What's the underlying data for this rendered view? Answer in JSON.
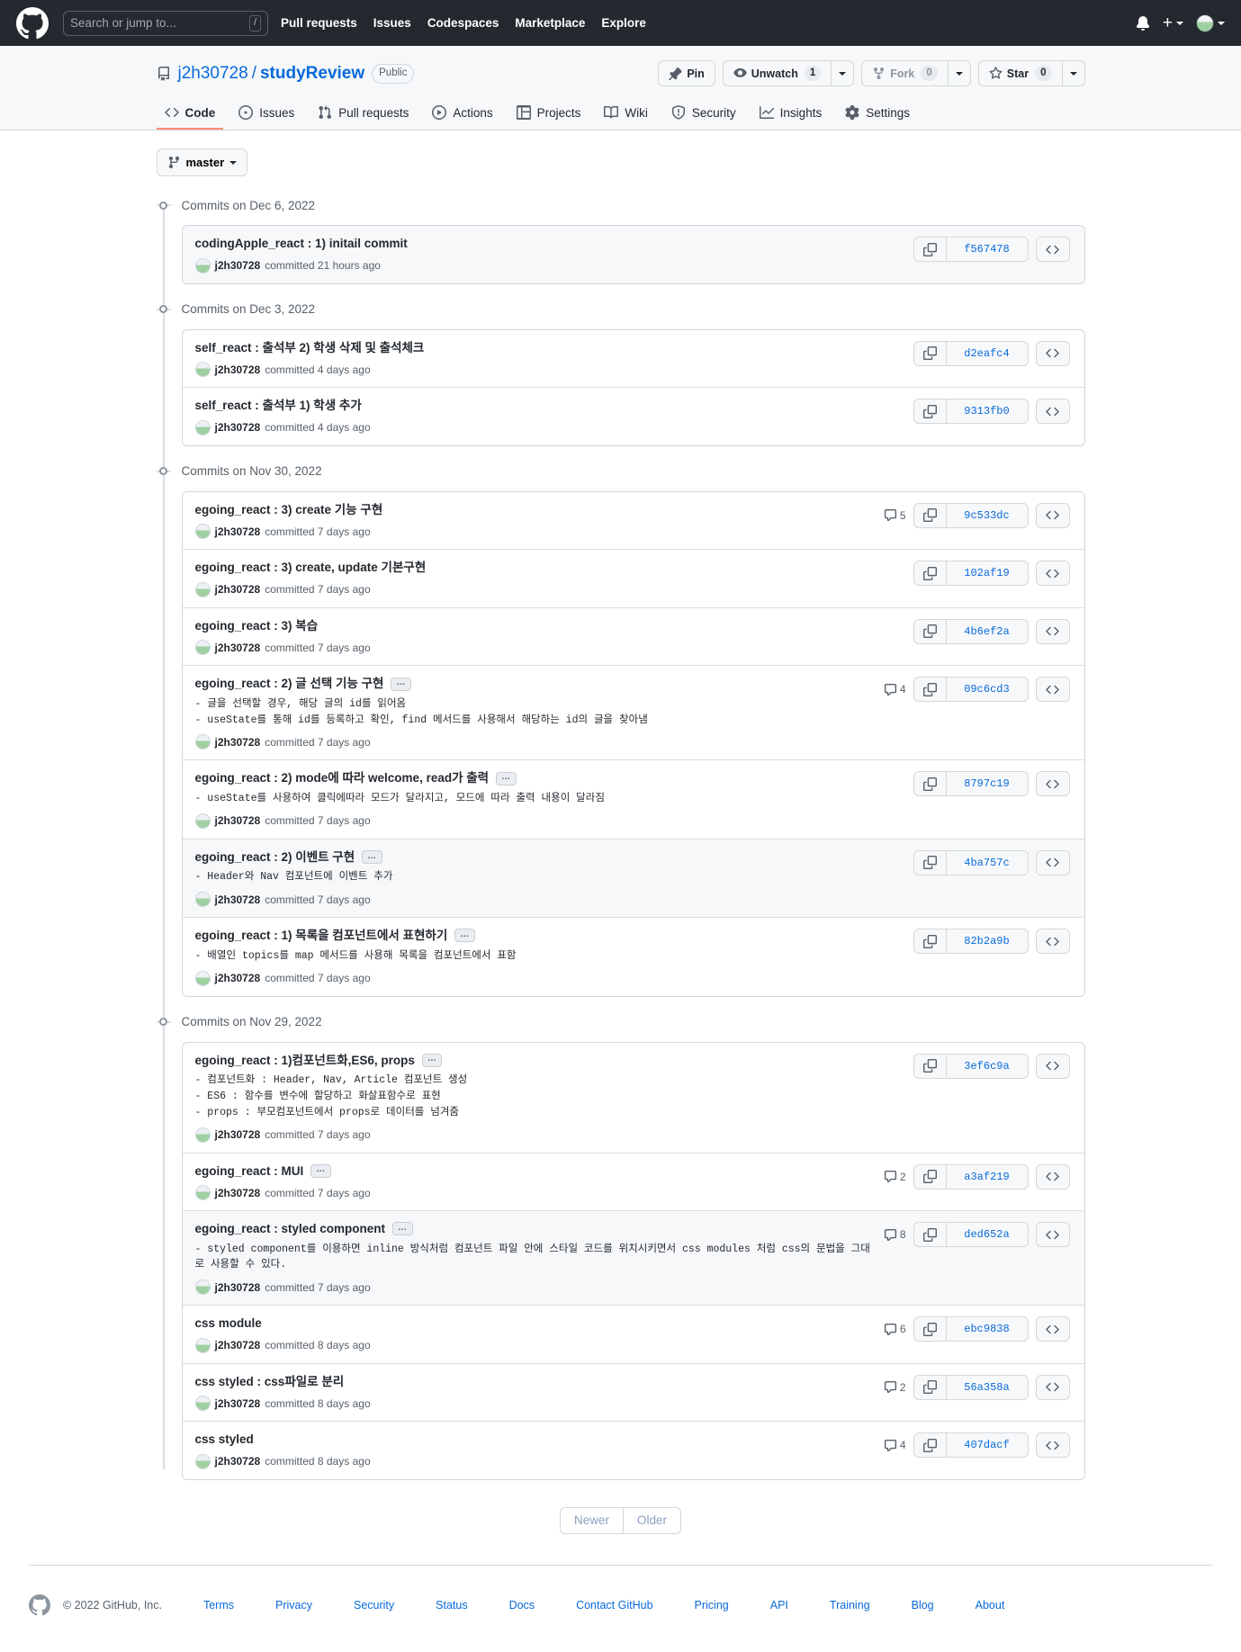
{
  "header": {
    "logo_icon": "github-mark-icon",
    "search": {
      "placeholder": "Search or jump to...",
      "shortcut": "/"
    },
    "nav": [
      {
        "label": "Pull requests"
      },
      {
        "label": "Issues"
      },
      {
        "label": "Codespaces"
      },
      {
        "label": "Marketplace"
      },
      {
        "label": "Explore"
      }
    ],
    "notifications_icon": "bell-icon",
    "create_new_icon": "plus-icon",
    "avatar_icon": "avatar"
  },
  "repo": {
    "owner": "j2h30728",
    "separator": "/",
    "name": "studyReview",
    "visibility": "Public",
    "actions": {
      "pin": {
        "label": "Pin",
        "icon": "pin-icon"
      },
      "unwatch": {
        "label": "Unwatch",
        "count": "1",
        "icon": "eye-icon"
      },
      "fork": {
        "label": "Fork",
        "count": "0",
        "icon": "fork-icon"
      },
      "star": {
        "label": "Star",
        "count": "0",
        "icon": "star-icon"
      }
    },
    "tabs": [
      {
        "label": "Code",
        "icon": "code-icon",
        "selected": true
      },
      {
        "label": "Issues",
        "icon": "issue-opened-icon",
        "selected": false
      },
      {
        "label": "Pull requests",
        "icon": "git-pull-request-icon",
        "selected": false
      },
      {
        "label": "Actions",
        "icon": "play-icon",
        "selected": false
      },
      {
        "label": "Projects",
        "icon": "table-icon",
        "selected": false
      },
      {
        "label": "Wiki",
        "icon": "book-icon",
        "selected": false
      },
      {
        "label": "Security",
        "icon": "shield-icon",
        "selected": false
      },
      {
        "label": "Insights",
        "icon": "graph-icon",
        "selected": false
      },
      {
        "label": "Settings",
        "icon": "gear-icon",
        "selected": false
      }
    ]
  },
  "branch_selector": {
    "label": "master",
    "icon": "git-branch-icon"
  },
  "commit_groups": [
    {
      "date_label": "Commits on Dec 6, 2022",
      "commits": [
        {
          "title": "codingApple_react : 1) initail commit",
          "has_ellipsis": false,
          "body": "",
          "author": "j2h30728",
          "meta": "committed 21 hours ago",
          "comments": "",
          "sha": "f567478",
          "highlight": true
        }
      ]
    },
    {
      "date_label": "Commits on Dec 3, 2022",
      "commits": [
        {
          "title": "self_react : 출석부 2) 학생 삭제 및 출석체크",
          "has_ellipsis": false,
          "body": "",
          "author": "j2h30728",
          "meta": "committed 4 days ago",
          "comments": "",
          "sha": "d2eafc4",
          "highlight": false
        },
        {
          "title": "self_react : 출석부 1) 학생 추가",
          "has_ellipsis": false,
          "body": "",
          "author": "j2h30728",
          "meta": "committed 4 days ago",
          "comments": "",
          "sha": "9313fb0",
          "highlight": false
        }
      ]
    },
    {
      "date_label": "Commits on Nov 30, 2022",
      "commits": [
        {
          "title": "egoing_react : 3) create 기능 구현",
          "has_ellipsis": false,
          "body": "",
          "author": "j2h30728",
          "meta": "committed 7 days ago",
          "comments": "5",
          "sha": "9c533dc",
          "highlight": false
        },
        {
          "title": "egoing_react : 3) create, update 기본구현",
          "has_ellipsis": false,
          "body": "",
          "author": "j2h30728",
          "meta": "committed 7 days ago",
          "comments": "",
          "sha": "102af19",
          "highlight": false
        },
        {
          "title": "egoing_react : 3) 복습",
          "has_ellipsis": false,
          "body": "",
          "author": "j2h30728",
          "meta": "committed 7 days ago",
          "comments": "",
          "sha": "4b6ef2a",
          "highlight": false
        },
        {
          "title": "egoing_react : 2) 글 선택 기능 구현",
          "has_ellipsis": true,
          "body": "- 글을 선택할 경우, 해당 글의 id를 읽어옴\n- useState를 통해 id를 등록하고 확인, find 메서드를 사용해서 해당하는 id의 글을 찾아냄",
          "author": "j2h30728",
          "meta": "committed 7 days ago",
          "comments": "4",
          "sha": "09c6cd3",
          "highlight": false
        },
        {
          "title": "egoing_react : 2) mode에 따라 welcome, read가 출력",
          "has_ellipsis": true,
          "body": "- useState를 사용하여 클릭에따라 모드가 달라지고, 모드에 따라 출력 내용이 달라짐",
          "author": "j2h30728",
          "meta": "committed 7 days ago",
          "comments": "",
          "sha": "8797c19",
          "highlight": false
        },
        {
          "title": "egoing_react : 2) 이벤트 구현",
          "has_ellipsis": true,
          "body": "- Header와 Nav 컴포넌트에 이벤트 추가",
          "author": "j2h30728",
          "meta": "committed 7 days ago",
          "comments": "",
          "sha": "4ba757c",
          "highlight": true
        },
        {
          "title": "egoing_react : 1) 목록을 컴포넌트에서 표현하기",
          "has_ellipsis": true,
          "body": "- 배열인 topics를 map 메서드를 사용해 목록을 컴포넌트에서 표함",
          "author": "j2h30728",
          "meta": "committed 7 days ago",
          "comments": "",
          "sha": "82b2a9b",
          "highlight": false
        }
      ]
    },
    {
      "date_label": "Commits on Nov 29, 2022",
      "commits": [
        {
          "title": "egoing_react : 1)컴포넌트화,ES6, props",
          "has_ellipsis": true,
          "body": "- 컴포넌트화 : Header, Nav, Article 컴포넌트 생성\n- ES6 : 함수를 변수에 할당하고 화살표함수로 표현\n- props : 부모컴포넌트에서 props로 데이터를 넘겨줌",
          "author": "j2h30728",
          "meta": "committed 7 days ago",
          "comments": "",
          "sha": "3ef6c9a",
          "highlight": false
        },
        {
          "title": "egoing_react : MUI",
          "has_ellipsis": true,
          "body": "",
          "author": "j2h30728",
          "meta": "committed 7 days ago",
          "comments": "2",
          "sha": "a3af219",
          "highlight": false
        },
        {
          "title": "egoing_react : styled component",
          "has_ellipsis": true,
          "body": "- styled component를 이용하면 inline 방식처럼 컴포넌트 파일 안에 스타일 코드를 위치시키면서 css modules 처럼 css의 문법을 그대로 사용할 수 있다.",
          "author": "j2h30728",
          "meta": "committed 7 days ago",
          "comments": "8",
          "sha": "ded652a",
          "highlight": true
        },
        {
          "title": "css module",
          "has_ellipsis": false,
          "body": "",
          "author": "j2h30728",
          "meta": "committed 8 days ago",
          "comments": "6",
          "sha": "ebc9838",
          "highlight": false
        },
        {
          "title": "css styled : css파일로 분리",
          "has_ellipsis": false,
          "body": "",
          "author": "j2h30728",
          "meta": "committed 8 days ago",
          "comments": "2",
          "sha": "56a358a",
          "highlight": false
        },
        {
          "title": "css styled",
          "has_ellipsis": false,
          "body": "",
          "author": "j2h30728",
          "meta": "committed 8 days ago",
          "comments": "4",
          "sha": "407dacf",
          "highlight": false
        }
      ]
    }
  ],
  "pagination": {
    "newer": "Newer",
    "older": "Older"
  },
  "footer": {
    "logo_icon": "github-mark-icon",
    "copyright": "© 2022 GitHub, Inc.",
    "links": [
      {
        "label": "Terms"
      },
      {
        "label": "Privacy"
      },
      {
        "label": "Security"
      },
      {
        "label": "Status"
      },
      {
        "label": "Docs"
      },
      {
        "label": "Contact GitHub"
      },
      {
        "label": "Pricing"
      },
      {
        "label": "API"
      },
      {
        "label": "Training"
      },
      {
        "label": "Blog"
      },
      {
        "label": "About"
      }
    ]
  },
  "colors": {
    "header_bg": "#24292f",
    "link": "#0969da",
    "selected_tab_underline": "#fd8c73",
    "border": "#d0d7de",
    "muted_text": "#57606a"
  }
}
